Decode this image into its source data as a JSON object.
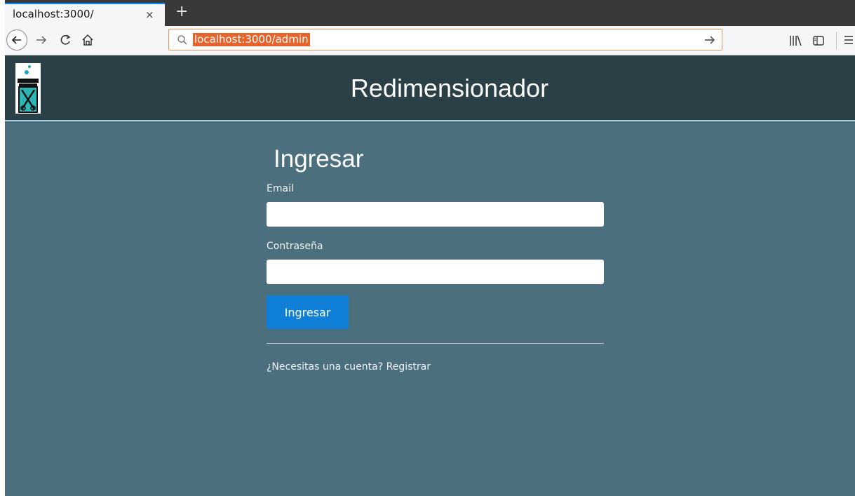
{
  "browser": {
    "tab": {
      "title": "localhost:3000/",
      "close": "×"
    },
    "new_tab": "+",
    "url": "localhost:3000/admin",
    "icons": [
      "back-icon",
      "forward-icon",
      "reload-icon",
      "home-icon",
      "search-icon",
      "go-arrow-icon",
      "library-icon",
      "sidebar-icon",
      "menu-icon"
    ]
  },
  "site": {
    "title": "Redimensionador",
    "logo": "jar-scissors-logo"
  },
  "login": {
    "heading": "Ingresar",
    "email_label": "Email",
    "email_value": "",
    "password_label": "Contraseña",
    "password_value": "",
    "submit_label": "Ingresar",
    "register_link": "¿Necesitas una cuenta? Registrar"
  },
  "colors": {
    "page_bg": "#4c6f7d",
    "header_bg": "#2b3f46",
    "button": "#0f7fd8",
    "url_highlight": "#e8632b"
  }
}
